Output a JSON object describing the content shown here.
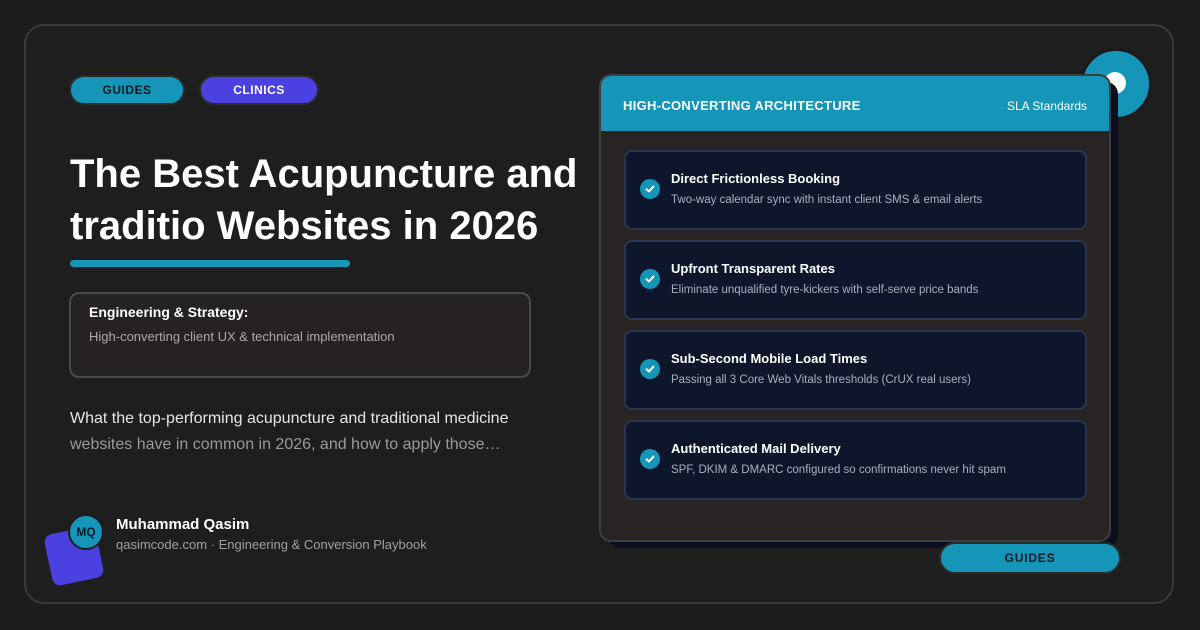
{
  "tags": {
    "guides": "GUIDES",
    "clinics": "CLINICS"
  },
  "title": {
    "line1": "The Best Acupuncture and",
    "line2": "traditio Websites in 2026"
  },
  "strategy": {
    "title": "Engineering & Strategy:",
    "subtitle": "High-converting client UX & technical implementation"
  },
  "description": {
    "line1": "What the top-performing acupuncture and traditional medicine",
    "line2": "websites have in common in 2026, and how to apply those…"
  },
  "author": {
    "initials": "MQ",
    "name": "Muhammad Qasim",
    "subtitle": "qasimcode.com · Engineering & Conversion Playbook"
  },
  "card": {
    "title": "HIGH-CONVERTING ARCHITECTURE",
    "badge": "SLA Standards",
    "items": [
      {
        "title": "Direct Frictionless Booking",
        "subtitle": "Two-way calendar sync with instant client SMS & email alerts"
      },
      {
        "title": "Upfront Transparent Rates",
        "subtitle": "Eliminate unqualified tyre-kickers with self-serve price bands"
      },
      {
        "title": "Sub-Second Mobile Load Times",
        "subtitle": "Passing all 3 Core Web Vitals thresholds (CrUX real users)"
      },
      {
        "title": "Authenticated Mail Delivery",
        "subtitle": "SPF, DKIM & DMARC configured so confirmations never hit spam"
      }
    ]
  },
  "bottom_tag": "GUIDES",
  "colors": {
    "accent": "#1596b8",
    "purple": "#4a41e0",
    "background": "#1c1c1c",
    "card_item": "#0d162b"
  },
  "icons": {
    "check": "check-circle-icon"
  }
}
